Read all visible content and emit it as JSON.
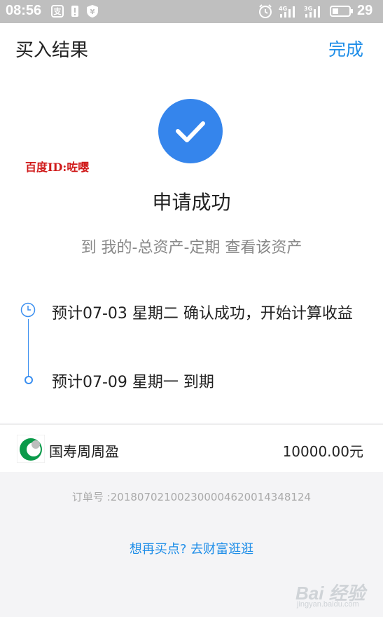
{
  "status_bar": {
    "time": "08:56",
    "battery": "29",
    "signal_1": "4G",
    "signal_2": "3G"
  },
  "header": {
    "title": "买入结果",
    "done_label": "完成"
  },
  "result": {
    "watermark": "百度ID:咗嘤",
    "title": "申请成功",
    "subtitle": "到 我的-总资产-定期 查看该资产"
  },
  "timeline": [
    {
      "text": "预计07-03 星期二 确认成功，开始计算收益"
    },
    {
      "text": "预计07-09 星期一 到期"
    }
  ],
  "product": {
    "name": "国寿周周盈",
    "amount": "10000.00元"
  },
  "order_number": "订单号 :20180702100230000462001434812​4",
  "wealth_link": "想再买点? 去财富逛逛",
  "site_watermark": {
    "brand": "Bai 经验",
    "url": "jingyan.baidu.com"
  },
  "colors": {
    "accent": "#1f8ee8",
    "check": "#3585ec",
    "watermark_red": "#d01a1a"
  }
}
